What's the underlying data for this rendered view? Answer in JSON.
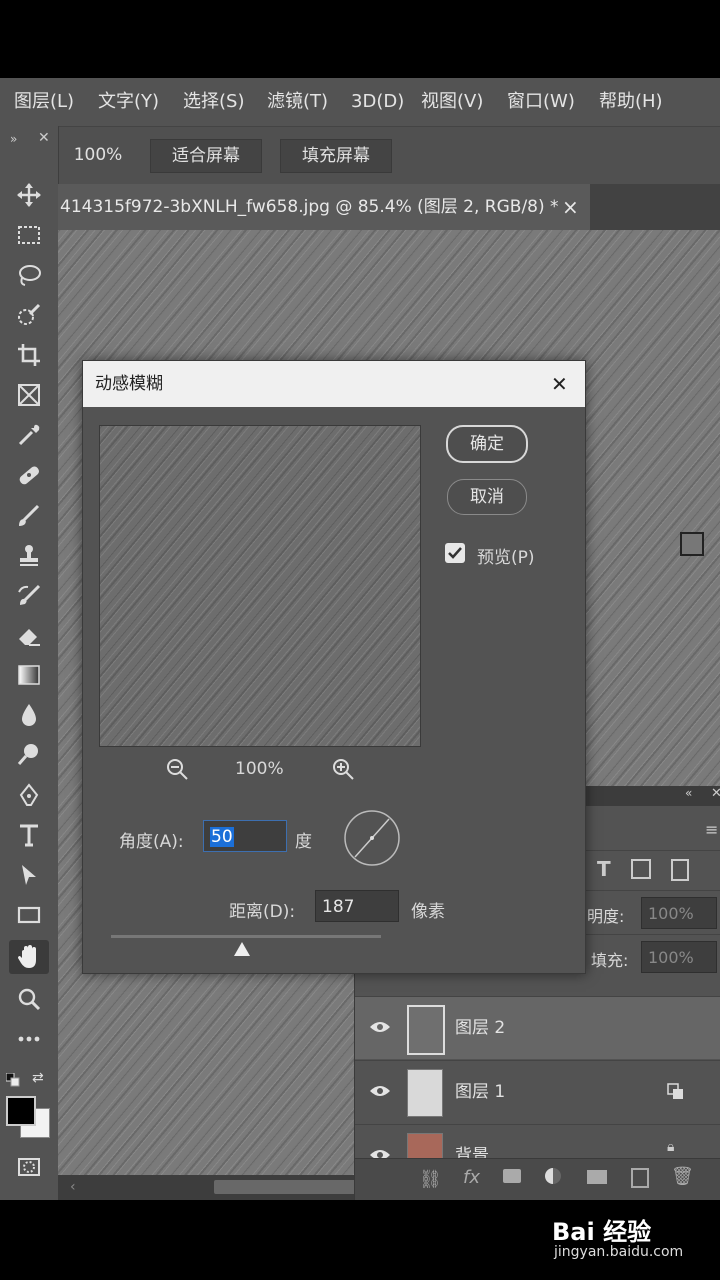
{
  "menu": [
    "图层(L)",
    "文字(Y)",
    "选择(S)",
    "滤镜(T)",
    "3D(D)",
    "视图(V)",
    "窗口(W)",
    "帮助(H)"
  ],
  "options": {
    "zoom": "100%",
    "fit_screen": "适合屏幕",
    "fill_screen": "填充屏幕"
  },
  "document": {
    "tab_title": "414315f972-3bXNLH_fw658.jpg @ 85.4% (图层 2, RGB/8) *",
    "close": "×"
  },
  "dialog": {
    "title": "动感模糊",
    "close": "✕",
    "ok": "确定",
    "cancel": "取消",
    "preview_label": "预览(P)",
    "preview_checked": true,
    "zoom": "100%",
    "angle_label": "角度(A):",
    "angle_value": "50",
    "angle_unit": "度",
    "distance_label": "距离(D):",
    "distance_value": "187",
    "distance_unit": "像素"
  },
  "layers_panel": {
    "opacity_label": "明度:",
    "opacity_value": "100%",
    "fill_label": "填充:",
    "fill_value": "100%",
    "layers": [
      {
        "name": "图层 2",
        "selected": true
      },
      {
        "name": "图层 1",
        "selected": false
      },
      {
        "name": "背景",
        "selected": false
      }
    ]
  },
  "watermark": {
    "brand": "Bai 经验",
    "url": "jingyan.baidu.com"
  },
  "colors": {
    "panel": "#535353",
    "dialog_title_bg": "#f0f0f0",
    "selection": "#1b6fd8"
  }
}
